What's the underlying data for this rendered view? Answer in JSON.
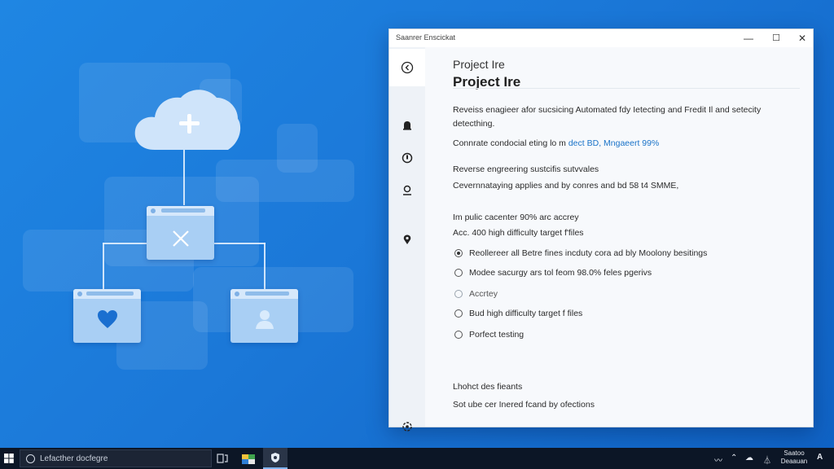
{
  "window": {
    "title": "Saanrer Enscickat",
    "controls": {
      "minimize": "—",
      "maximize": "☐",
      "close": "✕"
    }
  },
  "nav_icons": [
    "back-icon",
    "bell-icon",
    "shield-icon",
    "person-icon",
    "location-pin-icon",
    "settings-icon"
  ],
  "content": {
    "subtitle": "Project Ire",
    "title": "Project Ire",
    "description_line1": "Reveiss enagieer afor sucsicing Automated fdy Ietecting and Fredit Il and setecity",
    "description_line2": "detecthing.",
    "contrast_prefix": "Connrate condocial eting lo m ",
    "contrast_link": "dect BD, Mngaeert 99%",
    "reverse_line1": "Reverse engreering sustcifis sutvvales",
    "reverse_line2": "Cevernnataying applies and by conres and bd 58 t4 SMME,",
    "public_line": "Im pulic cacenter 90% arc accrey",
    "acc_line": "Acc. 400 high difficulty target f'files",
    "options": [
      {
        "label": "Reollereer all Betre fines incduty cora ad bly Moolony besitings",
        "state": "checked"
      },
      {
        "label": "Modee sacurgy ars tol feom 98.0% feles pgerivs",
        "state": "unchecked"
      },
      {
        "label": "Accrtey",
        "state": "light"
      },
      {
        "label": "Bud high difficulty target f files",
        "state": "unchecked"
      },
      {
        "label": "Porfect testing",
        "state": "unchecked"
      }
    ],
    "footer_line1": "Lhohct des fieants",
    "footer_line2": "Sot ube cer Inered fcand by ofections"
  },
  "taskbar": {
    "search_text": "Lefacther docfegre",
    "tray_time": "Saatoo",
    "tray_date": "Deaauan"
  },
  "colors": {
    "desktop": "#1b78d8",
    "accent_link": "#1a73c8",
    "taskbar": "#0c1626",
    "card": "#a9cff4"
  }
}
